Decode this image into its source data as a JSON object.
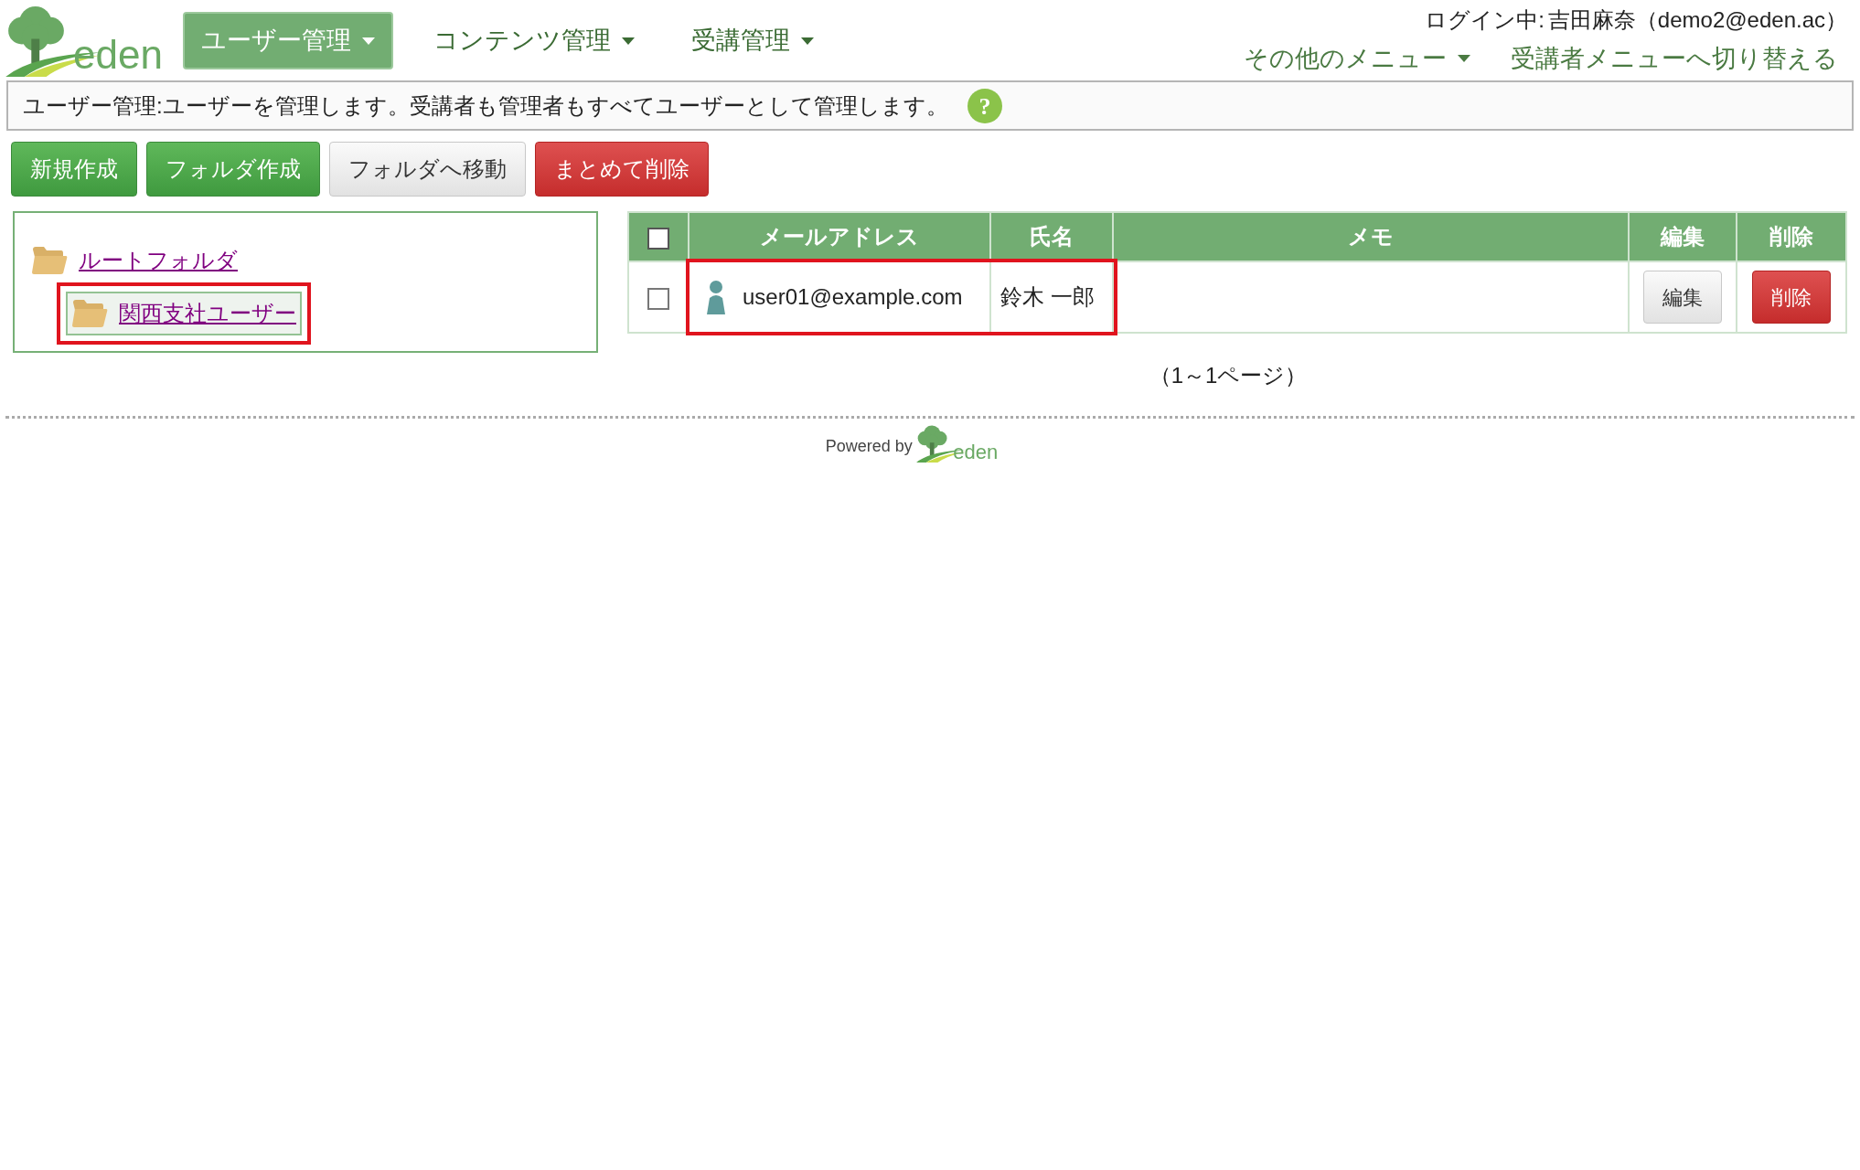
{
  "logo": {
    "text": "eden"
  },
  "nav": [
    {
      "label": "ユーザー管理",
      "selected": true
    },
    {
      "label": "コンテンツ管理",
      "selected": false
    },
    {
      "label": "受講管理",
      "selected": false
    }
  ],
  "login": {
    "label": "ログイン中:",
    "user": "吉田麻奈（demo2@eden.ac）"
  },
  "submenu": [
    {
      "label": "その他のメニュー",
      "dropdown": true
    },
    {
      "label": "受講者メニューへ切り替える",
      "dropdown": false
    }
  ],
  "info": {
    "text": "ユーザー管理:ユーザーを管理します。受講者も管理者もすべてユーザーとして管理します。",
    "help": "?"
  },
  "actions": [
    {
      "label": "新規作成",
      "kind": "primary"
    },
    {
      "label": "フォルダ作成",
      "kind": "primary"
    },
    {
      "label": "フォルダへ移動",
      "kind": "default"
    },
    {
      "label": "まとめて削除",
      "kind": "danger"
    }
  ],
  "folders": [
    {
      "label": "ルートフォルダ",
      "selected": false,
      "highlighted": false,
      "children": [
        {
          "label": "関西支社ユーザー",
          "selected": true,
          "highlighted": true
        }
      ]
    }
  ],
  "table": {
    "select_all": false,
    "columns": [
      "メールアドレス",
      "氏名",
      "メモ",
      "編集",
      "削除"
    ],
    "rows": [
      {
        "checked": false,
        "email": "user01@example.com",
        "name": "鈴木 一郎",
        "edit": "編集",
        "delete": "削除",
        "highlighted": true
      }
    ]
  },
  "pagination": "（1～1ページ）",
  "footer": {
    "powered_by": "Powered by",
    "logo_text": "eden"
  }
}
